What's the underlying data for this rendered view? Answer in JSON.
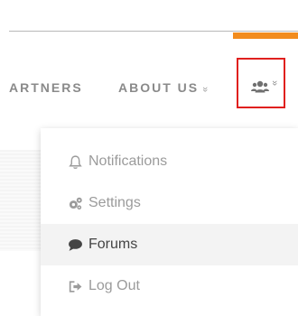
{
  "nav": {
    "items": [
      {
        "label": "ARTNERS",
        "chevron": ""
      },
      {
        "label": "ABOUT US",
        "chevron": "»"
      }
    ],
    "user_chevron": "»",
    "user_icon": "users-icon"
  },
  "dropdown": {
    "items": [
      {
        "label": "Notifications",
        "icon": "bell-icon"
      },
      {
        "label": "Settings",
        "icon": "gears-icon"
      },
      {
        "label": "Forums",
        "icon": "comment-icon"
      },
      {
        "label": "Log Out",
        "icon": "sign-out-icon"
      }
    ]
  },
  "colors": {
    "accent": "#f28c1e",
    "highlight_border": "#e0201e"
  }
}
